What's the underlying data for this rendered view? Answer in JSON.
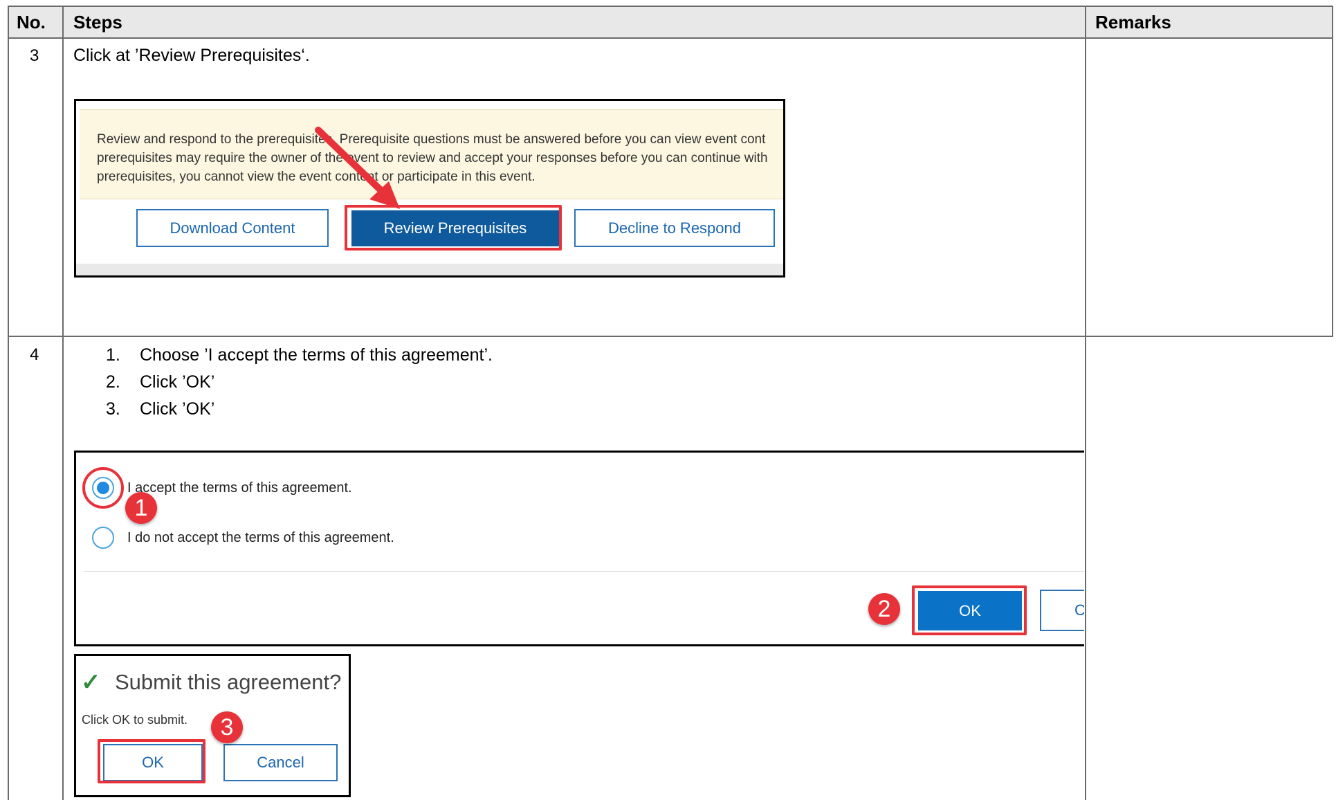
{
  "table": {
    "headers": {
      "no": "No.",
      "steps": "Steps",
      "remarks": "Remarks"
    }
  },
  "rows": [
    {
      "no": "3",
      "instruction": "Click at ’Review Prerequisites‘."
    },
    {
      "no": "4",
      "list": [
        {
          "n": "1.",
          "text": "Choose ’I accept the terms of this agreement’."
        },
        {
          "n": "2.",
          "text": "Click ’OK’"
        },
        {
          "n": "3.",
          "text": "Click ’OK’"
        }
      ]
    }
  ],
  "shot1": {
    "notice_lines": [
      "Review and respond to the prerequisites. Prerequisite questions must be answered before you can view event cont",
      "prerequisites may require the owner of the event to review and accept your responses before you can continue with",
      "prerequisites, you cannot view the event content or participate in this event."
    ],
    "buttons": {
      "download": "Download Content",
      "review": "Review Prerequisites",
      "decline": "Decline to Respond"
    }
  },
  "shot2": {
    "accept": "I accept the terms of this agreement.",
    "decline": "I do not accept the terms of this agreement.",
    "ok": "OK",
    "cancel_partial": "Ca",
    "badges": [
      "1",
      "2"
    ]
  },
  "shot3": {
    "title": "Submit this agreement?",
    "subtitle": "Click OK to submit.",
    "ok": "OK",
    "cancel": "Cancel",
    "badge": "3"
  },
  "colors": {
    "highlight": "#e8323a",
    "primary_button": "#0f5a9c",
    "link_blue": "#1a66b0",
    "notice_bg": "#fdf7e1",
    "radio_blue": "#1f8be0"
  }
}
